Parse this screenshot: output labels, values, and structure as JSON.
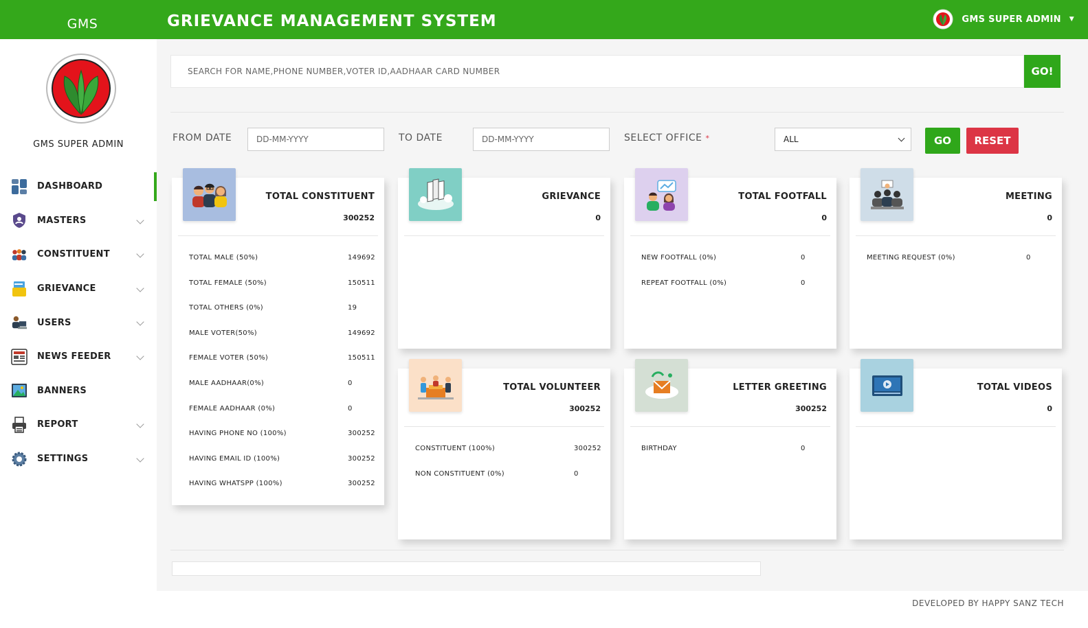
{
  "header": {
    "brand": "GMS",
    "title": "GRIEVANCE MANAGEMENT SYSTEM",
    "user_name": "GMS SUPER ADMIN"
  },
  "sidebar": {
    "user_name": "GMS SUPER ADMIN",
    "items": [
      {
        "label": "DASHBOARD",
        "icon": "dashboard-icon",
        "expandable": false,
        "active": true
      },
      {
        "label": "MASTERS",
        "icon": "shield-icon",
        "expandable": true
      },
      {
        "label": "CONSTITUENT",
        "icon": "people-icon",
        "expandable": true
      },
      {
        "label": "GRIEVANCE",
        "icon": "folder-icon",
        "expandable": true
      },
      {
        "label": "USERS",
        "icon": "user-computer-icon",
        "expandable": true
      },
      {
        "label": "NEWS FEEDER",
        "icon": "newspaper-icon",
        "expandable": true
      },
      {
        "label": "BANNERS",
        "icon": "image-icon",
        "expandable": false
      },
      {
        "label": "REPORT",
        "icon": "printer-icon",
        "expandable": true
      },
      {
        "label": "SETTINGS",
        "icon": "gear-icon",
        "expandable": true
      }
    ]
  },
  "search": {
    "placeholder": "SEARCH FOR NAME,PHONE NUMBER,VOTER ID,AADHAAR CARD NUMBER",
    "button": "GO!"
  },
  "filters": {
    "from_label": "FROM DATE",
    "from_placeholder": "DD-MM-YYYY",
    "to_label": "TO DATE",
    "to_placeholder": "DD-MM-YYYY",
    "office_label": "SELECT OFFICE",
    "office_required": "*",
    "office_value": "ALL",
    "go": "GO",
    "reset": "RESET"
  },
  "cards": {
    "constituent": {
      "title": "TOTAL CONSTITUENT",
      "count": "300252",
      "rows": [
        {
          "label": "TOTAL MALE (50%)",
          "value": "149692"
        },
        {
          "label": "TOTAL FEMALE (50%)",
          "value": "150511"
        },
        {
          "label": "TOTAL OTHERS (0%)",
          "value": "19"
        },
        {
          "label": "MALE VOTER(50%)",
          "value": "149692"
        },
        {
          "label": "FEMALE VOTER (50%)",
          "value": "150511"
        },
        {
          "label": "MALE AADHAAR(0%)",
          "value": "0"
        },
        {
          "label": "FEMALE AADHAAR (0%)",
          "value": "0"
        },
        {
          "label": "HAVING PHONE NO (100%)",
          "value": "300252"
        },
        {
          "label": "HAVING EMAIL ID (100%)",
          "value": "300252"
        },
        {
          "label": "HAVING WHATSPP (100%)",
          "value": "300252"
        }
      ]
    },
    "grievance": {
      "title": "GRIEVANCE",
      "count": "0"
    },
    "footfall": {
      "title": "TOTAL FOOTFALL",
      "count": "0",
      "rows": [
        {
          "label": "NEW FOOTFALL (0%)",
          "value": "0"
        },
        {
          "label": "REPEAT FOOTFALL (0%)",
          "value": "0"
        }
      ]
    },
    "meeting": {
      "title": "MEETING",
      "count": "0",
      "rows": [
        {
          "label": "MEETING REQUEST (0%)",
          "value": "0"
        }
      ]
    },
    "volunteer": {
      "title": "TOTAL VOLUNTEER",
      "count": "300252",
      "rows": [
        {
          "label": "CONSTITUENT (100%)",
          "value": "300252"
        },
        {
          "label": "NON CONSTITUENT (0%)",
          "value": "0"
        }
      ]
    },
    "letter": {
      "title": "LETTER GREETING",
      "count": "300252",
      "rows": [
        {
          "label": "BIRTHDAY",
          "value": "0"
        }
      ]
    },
    "videos": {
      "title": "TOTAL VIDEOS",
      "count": "0"
    }
  },
  "footer": "DEVELOPED BY HAPPY SANZ TECH",
  "colors": {
    "primary_green": "#34a81b",
    "reset_red": "#dc3545",
    "main_bg": "#f5f5f5"
  }
}
